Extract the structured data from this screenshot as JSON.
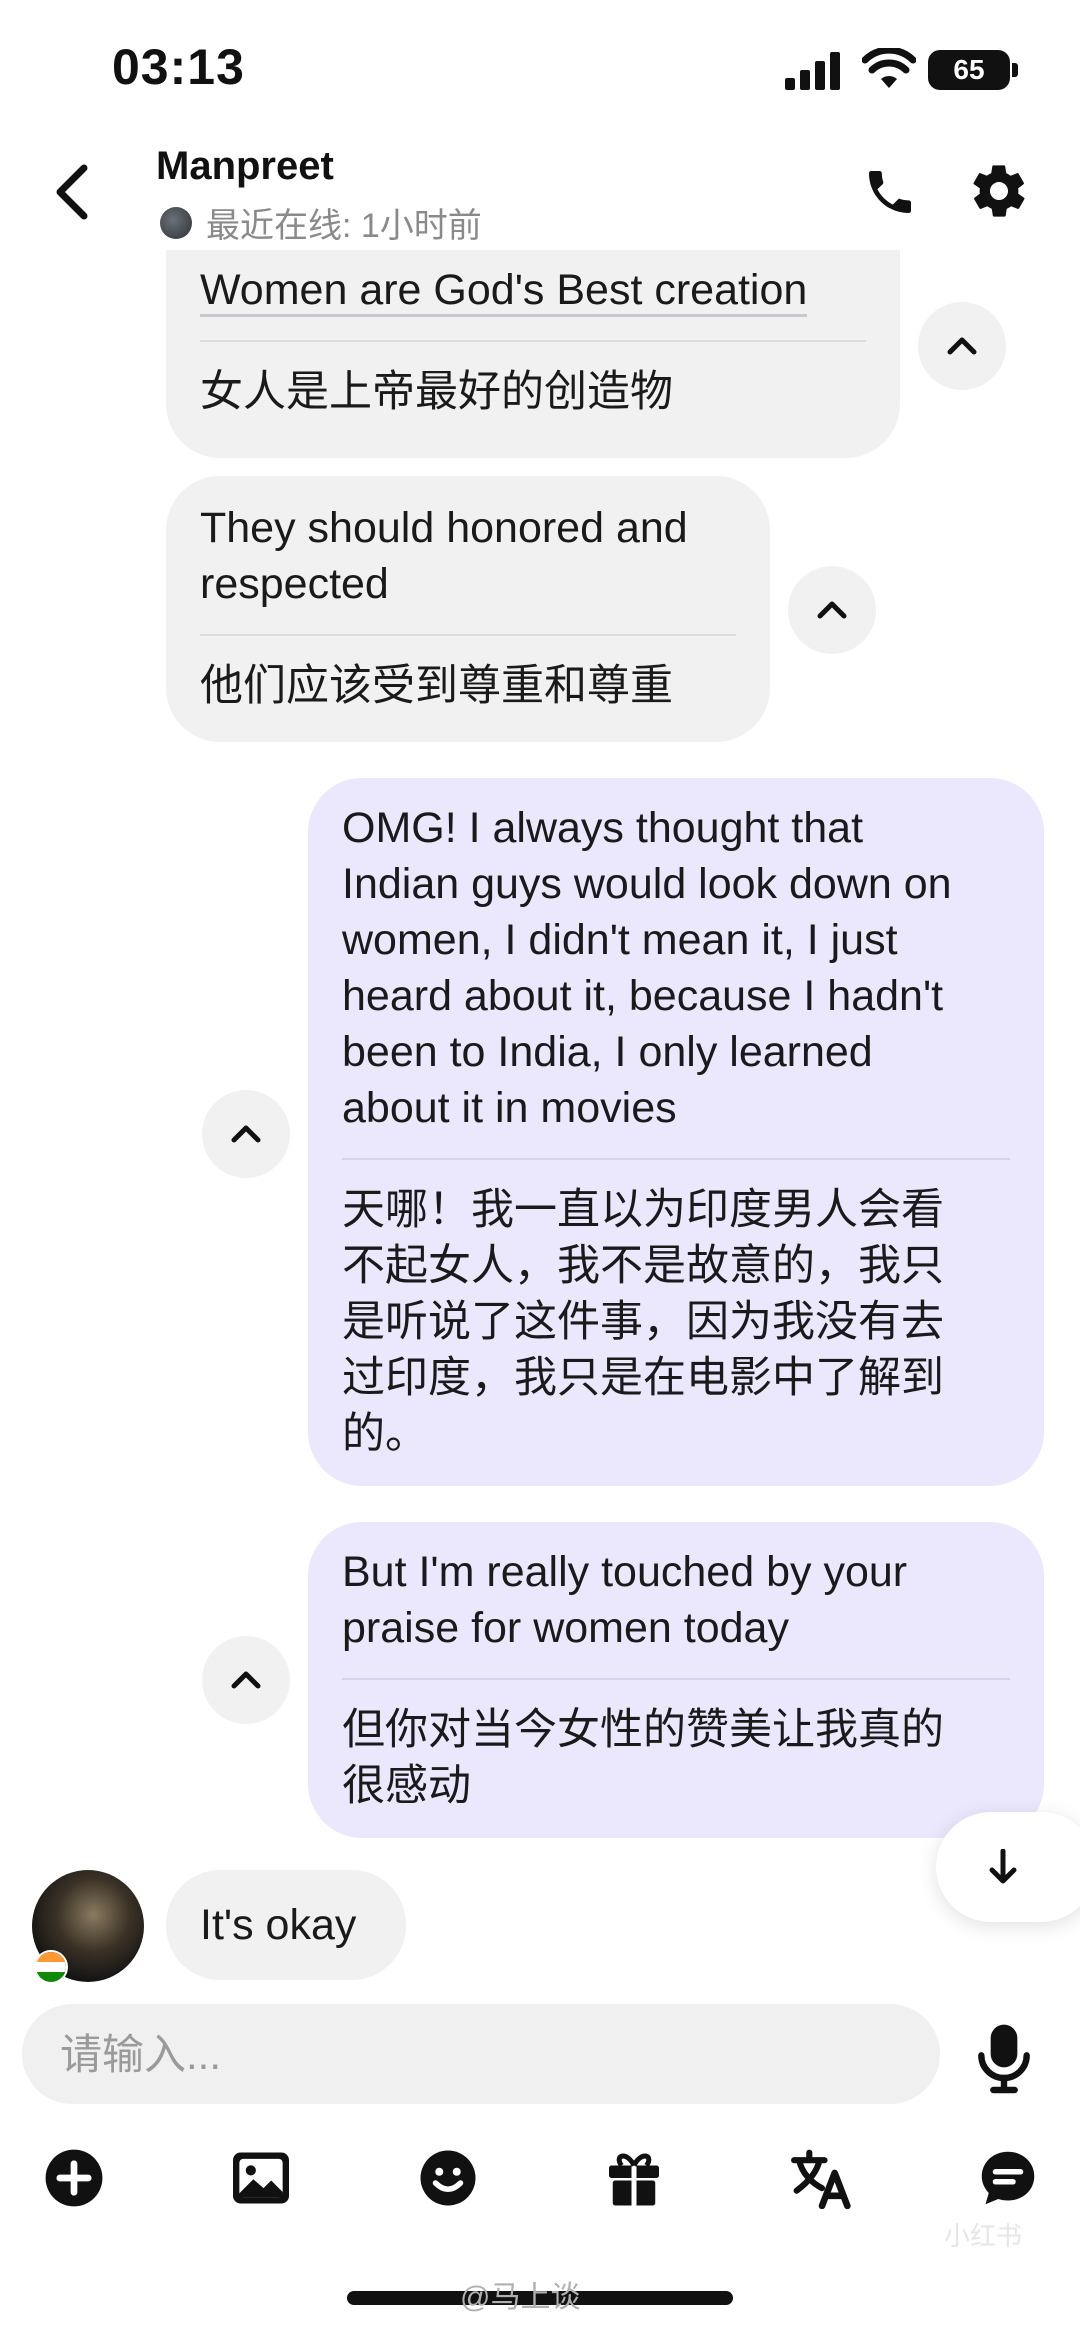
{
  "status_bar": {
    "time": "03:13",
    "battery": "65"
  },
  "header": {
    "contact_name": "Manpreet",
    "presence": "最近在线: 1小时前"
  },
  "messages": [
    {
      "original": "Women are God's Best creation",
      "translation": "女人是上帝最好的创造物"
    },
    {
      "original_line1": "They should honored and",
      "original_line2": "respected",
      "translation": "他们应该受到尊重和尊重"
    },
    {
      "original_lines": [
        "OMG!   I always thought that",
        "Indian guys would look down on",
        "women, I didn't mean it, I just",
        "heard about it, because I hadn't",
        "been to India, I only learned",
        "about it in movies"
      ],
      "translation_lines": [
        "天哪！我一直以为印度男人会看",
        "不起女人，我不是故意的，我只",
        "是听说了这件事，因为我没有去",
        "过印度，我只是在电影中了解到",
        "的。"
      ]
    },
    {
      "original_lines": [
        "But I'm really touched by your",
        "praise for women today"
      ],
      "translation_lines": [
        "但你对当今女性的赞美让我真的",
        "很感动"
      ]
    },
    {
      "text": "It's okay"
    }
  ],
  "composer": {
    "placeholder": "请输入..."
  },
  "toolbar": [
    "add-icon",
    "image-icon",
    "emoji-icon",
    "gift-icon",
    "translate-icon",
    "chat-icon"
  ],
  "watermark": {
    "text": "@马上谈",
    "small": "小红书"
  },
  "colors": {
    "incoming_bubble": "#f1f1f1",
    "outgoing_bubble": "#ebe8fd"
  }
}
